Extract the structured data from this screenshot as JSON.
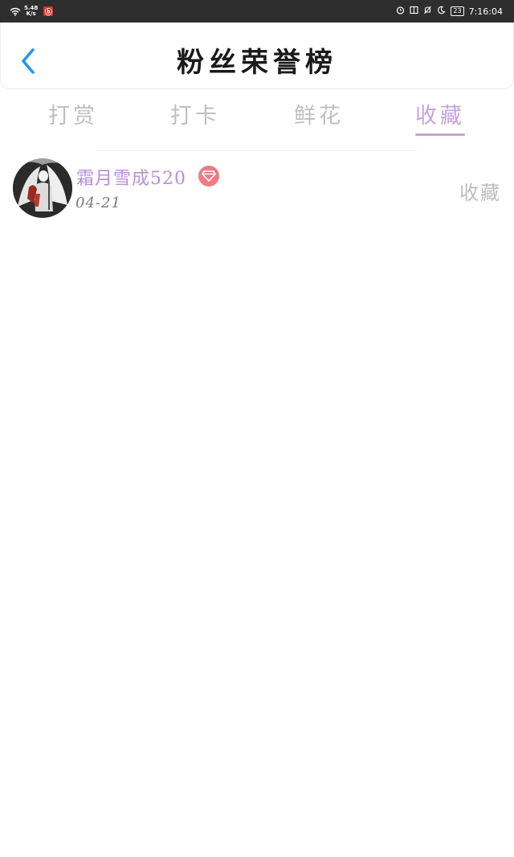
{
  "status_bar": {
    "net_speed_value": "5.48",
    "net_speed_unit": "K/s",
    "app_icon_glyph": "ⓑ",
    "battery": "23",
    "time": "7:16:04"
  },
  "header": {
    "title": "粉丝荣誉榜",
    "back_icon": "chevron-left-icon"
  },
  "tabs": [
    {
      "label": "打赏",
      "active": false
    },
    {
      "label": "打卡",
      "active": false
    },
    {
      "label": "鲜花",
      "active": false
    },
    {
      "label": "收藏",
      "active": true
    }
  ],
  "list": [
    {
      "username": "霜月雪成520",
      "date": "04-21",
      "action": "收藏",
      "badge_icon": "diamond-icon"
    }
  ],
  "colors": {
    "accent": "#c4a4de",
    "username": "#b98fd6",
    "badge": "#f07a86",
    "back": "#2196f3",
    "status_bar": "#2e2e2e"
  }
}
